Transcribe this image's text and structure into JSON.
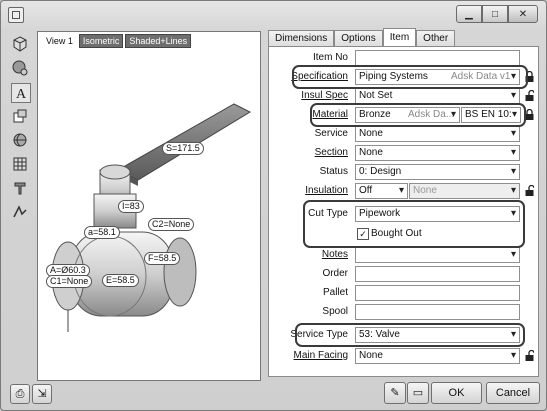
{
  "view": {
    "tabs": [
      "View 1",
      "Isometric",
      "Shaded+Lines"
    ],
    "labels": [
      "S=171.5",
      "I=83",
      "a=58.1",
      "C2=None",
      "A=Ø60.3",
      "C1=None",
      "E=58.5",
      "F=58.5"
    ]
  },
  "tabs": [
    "Dimensions",
    "Options",
    "Item",
    "Other"
  ],
  "selected_tab": "Item",
  "fields": {
    "item_no": {
      "label": "Item No",
      "value": ""
    },
    "specification": {
      "label": "Specification",
      "value": "Piping Systems",
      "extra": "Adsk Data v1"
    },
    "insul_spec": {
      "label": "Insul Spec",
      "value": "Not Set"
    },
    "material": {
      "label": "Material",
      "value": "Bronze",
      "extra": "Adsk Da...",
      "gauge": "BS EN 10:"
    },
    "service": {
      "label": "Service",
      "value": "None"
    },
    "section": {
      "label": "Section",
      "value": "None"
    },
    "status": {
      "label": "Status",
      "value": "0: Design"
    },
    "insulation": {
      "label": "Insulation",
      "value": "Off",
      "extra": "None"
    },
    "cut_type": {
      "label": "Cut Type",
      "value": "Pipework"
    },
    "bought_out": {
      "label": "Bought Out",
      "checked": true
    },
    "notes": {
      "label": "Notes",
      "value": ""
    },
    "order": {
      "label": "Order",
      "value": ""
    },
    "pallet": {
      "label": "Pallet",
      "value": ""
    },
    "spool": {
      "label": "Spool",
      "value": ""
    },
    "service_type": {
      "label": "Service Type",
      "value": "53: Valve"
    },
    "main_facing": {
      "label": "Main Facing",
      "value": "None"
    }
  },
  "buttons": {
    "ok": "OK",
    "cancel": "Cancel"
  },
  "icons": [
    "cube-icon",
    "sphere-icon",
    "text-icon",
    "stack-icon",
    "globe-icon",
    "grid-icon",
    "tool-icon",
    "axis-icon",
    "print-icon",
    "export-icon",
    "edit-icon",
    "open-icon",
    "minimize-icon",
    "maximize-icon",
    "close-icon"
  ]
}
